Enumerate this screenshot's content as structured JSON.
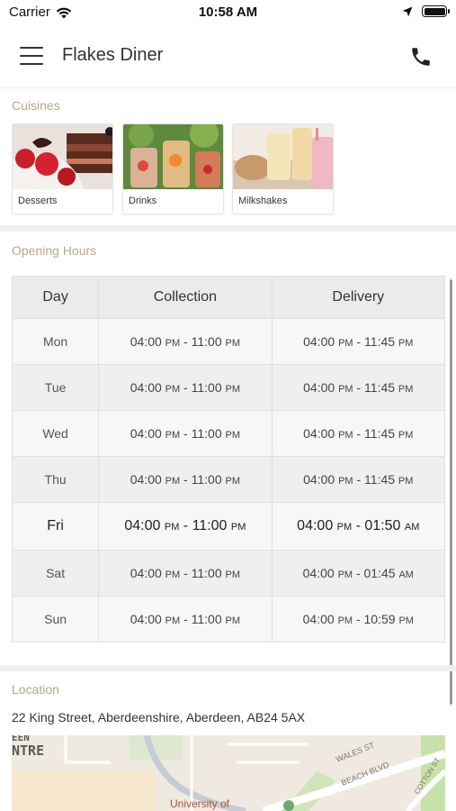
{
  "status_bar": {
    "carrier": "Carrier",
    "time": "10:58 AM"
  },
  "header": {
    "title": "Flakes Diner",
    "menu_icon": "hamburger-menu-icon",
    "phone_icon": "phone-icon"
  },
  "cuisines": {
    "title": "Cuisines",
    "items": [
      {
        "label": "Desserts",
        "image": "desserts-image"
      },
      {
        "label": "Drinks",
        "image": "drinks-image"
      },
      {
        "label": "Milkshakes",
        "image": "milkshakes-image"
      }
    ]
  },
  "opening_hours": {
    "title": "Opening Hours",
    "columns": [
      "Day",
      "Collection",
      "Delivery"
    ],
    "rows": [
      {
        "day": "Mon",
        "collection": {
          "open": "04:00",
          "open_ampm": "PM",
          "close": "11:00",
          "close_ampm": "PM"
        },
        "delivery": {
          "open": "04:00",
          "open_ampm": "PM",
          "close": "11:45",
          "close_ampm": "PM"
        }
      },
      {
        "day": "Tue",
        "collection": {
          "open": "04:00",
          "open_ampm": "PM",
          "close": "11:00",
          "close_ampm": "PM"
        },
        "delivery": {
          "open": "04:00",
          "open_ampm": "PM",
          "close": "11:45",
          "close_ampm": "PM"
        }
      },
      {
        "day": "Wed",
        "collection": {
          "open": "04:00",
          "open_ampm": "PM",
          "close": "11:00",
          "close_ampm": "PM"
        },
        "delivery": {
          "open": "04:00",
          "open_ampm": "PM",
          "close": "11:45",
          "close_ampm": "PM"
        }
      },
      {
        "day": "Thu",
        "collection": {
          "open": "04:00",
          "open_ampm": "PM",
          "close": "11:00",
          "close_ampm": "PM"
        },
        "delivery": {
          "open": "04:00",
          "open_ampm": "PM",
          "close": "11:45",
          "close_ampm": "PM"
        }
      },
      {
        "day": "Fri",
        "collection": {
          "open": "04:00",
          "open_ampm": "PM",
          "close": "11:00",
          "close_ampm": "PM"
        },
        "delivery": {
          "open": "04:00",
          "open_ampm": "PM",
          "close": "01:50",
          "close_ampm": "AM"
        }
      },
      {
        "day": "Sat",
        "collection": {
          "open": "04:00",
          "open_ampm": "PM",
          "close": "11:00",
          "close_ampm": "PM"
        },
        "delivery": {
          "open": "04:00",
          "open_ampm": "PM",
          "close": "01:45",
          "close_ampm": "AM"
        }
      },
      {
        "day": "Sun",
        "collection": {
          "open": "04:00",
          "open_ampm": "PM",
          "close": "11:00",
          "close_ampm": "PM"
        },
        "delivery": {
          "open": "04:00",
          "open_ampm": "PM",
          "close": "10:59",
          "close_ampm": "PM"
        }
      }
    ]
  },
  "location": {
    "title": "Location",
    "address": "22 King Street, Aberdeenshire, Aberdeen, AB24 5AX",
    "map_labels": {
      "area": "NTRE",
      "area_top": "EEN",
      "street_1": "WALES ST",
      "street_2": "BEACH BLVD",
      "street_3": "COTTON ST",
      "poi": "University of"
    }
  },
  "colors": {
    "section_title": "#b8a882",
    "header_bg": "#ebebeb",
    "map_bg": "#efe9df"
  }
}
